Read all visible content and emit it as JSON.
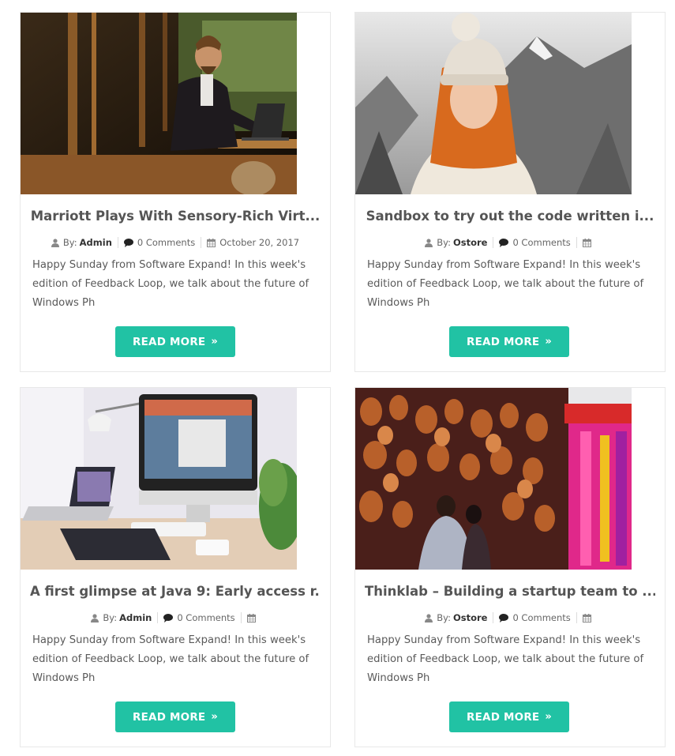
{
  "posts": [
    {
      "title": "Marriott Plays With Sensory-Rich Virt...",
      "by_label": "By:",
      "author": "Admin",
      "comments": "0 Comments",
      "date": "October 20, 2017",
      "excerpt": "Happy Sunday from Software Expand! In this week's edition of Feedback Loop, we talk about the future of Windows Ph",
      "button": "READ MORE",
      "image": "man-with-laptop-in-cafe"
    },
    {
      "title": "Sandbox to try out the code written i...",
      "by_label": "By:",
      "author": "Ostore",
      "comments": "0 Comments",
      "date": "",
      "excerpt": "Happy Sunday from Software Expand! In this week's edition of Feedback Loop, we talk about the future of Windows Ph",
      "button": "READ MORE",
      "image": "woman-in-knit-hat-winter"
    },
    {
      "title": "A first glimpse at Java 9: Early access r...",
      "by_label": "By:",
      "author": "Admin",
      "comments": "0 Comments",
      "date": "",
      "excerpt": "Happy Sunday from Software Expand! In this week's edition of Feedback Loop, we talk about the future of Windows Ph",
      "button": "READ MORE",
      "image": "desk-with-imac-and-laptop"
    },
    {
      "title": "Thinklab – Building a startup team to ...",
      "by_label": "By:",
      "author": "Ostore",
      "comments": "0 Comments",
      "date": "",
      "excerpt": "Happy Sunday from Software Expand! In this week's edition of Feedback Loop, we talk about the future of Windows Ph",
      "button": "READ MORE",
      "image": "market-with-hanging-bags"
    }
  ],
  "colors": {
    "accent": "#21c2a4",
    "title": "#555555",
    "text": "#5a5a5a",
    "border": "#e8e8e8"
  },
  "icons": {
    "author": "user-icon",
    "comments": "comment-icon",
    "date": "calendar-icon",
    "button": "chevron-double-right-icon"
  }
}
